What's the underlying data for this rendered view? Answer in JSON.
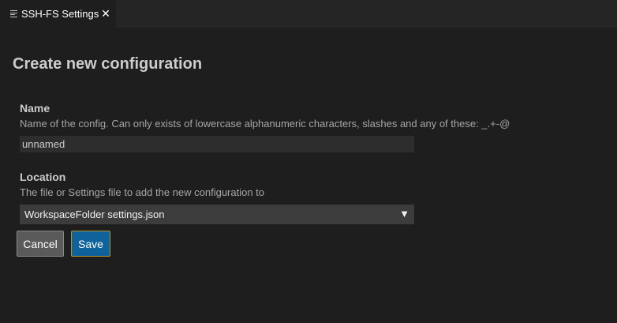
{
  "tab": {
    "title": "SSH-FS Settings",
    "close_glyph": "✕",
    "icon": "lines-icon"
  },
  "page": {
    "title": "Create new configuration"
  },
  "name_field": {
    "label": "Name",
    "description": "Name of the config. Can only exists of lowercase alphanumeric characters, slashes and any of these: _.+-@",
    "value": "unnamed"
  },
  "location_field": {
    "label": "Location",
    "description": "The file or Settings file to add the new configuration to",
    "selected": "WorkspaceFolder settings.json",
    "arrow": "▼"
  },
  "buttons": {
    "cancel": "Cancel",
    "save": "Save"
  },
  "colors": {
    "background": "#1e1e1e",
    "tabbar": "#252526",
    "primary_button": "#0e639c",
    "secondary_button": "#5a5a5a"
  }
}
